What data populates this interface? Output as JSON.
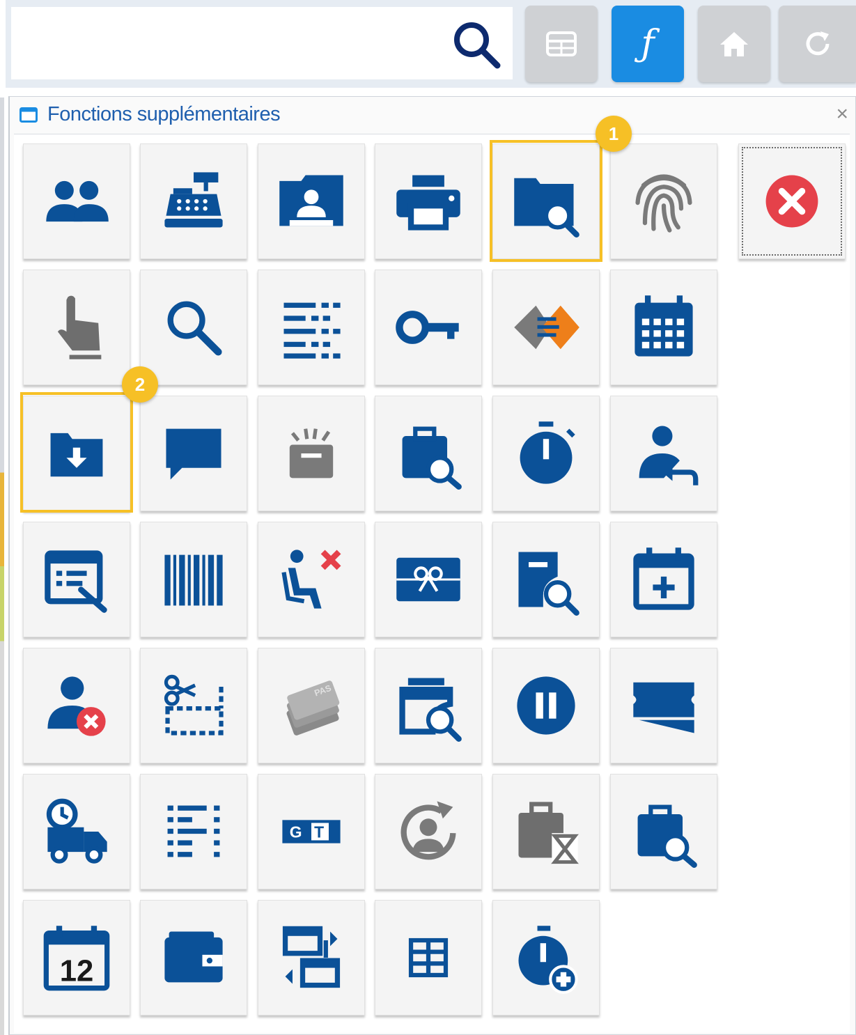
{
  "panel": {
    "title": "Fonctions supplémentaires",
    "close_glyph": "×"
  },
  "toolbar": {
    "buttons": [
      {
        "name": "grid-view-icon",
        "color": "#cfd1d4"
      },
      {
        "name": "function-icon",
        "color": "#1a8ce2",
        "label": "ƒ"
      },
      {
        "name": "home-icon",
        "color": "#cfd1d4"
      },
      {
        "name": "refresh-icon",
        "color": "#cfd1d4"
      }
    ]
  },
  "colors": {
    "primary": "#0b5198",
    "accent_blue": "#1a8ce2",
    "highlight": "#f6c026",
    "danger": "#e5414a",
    "grey": "#7a7a7a",
    "orange": "#ee7f1a"
  },
  "badges": [
    "1",
    "2"
  ],
  "tiles": [
    "users-icon",
    "cash-register-icon",
    "contact-folder-icon",
    "printer-icon",
    "folder-search-icon",
    "fingerprint-icon",
    "close-circle-icon",
    "hand-pointer-icon",
    "search-icon",
    "list-icon",
    "key-icon",
    "diamond-arrows-icon",
    "calendar-grid-icon",
    "folder-download-icon",
    "chat-bubble-icon",
    "broken-box-icon",
    "bag-search-icon",
    "stopwatch-icon",
    "user-return-icon",
    "form-edit-icon",
    "barcode-icon",
    "no-seat-icon",
    "gift-card-icon",
    "document-search-icon",
    "calendar-add-icon",
    "user-remove-icon",
    "cut-coupon-icon",
    "cards-stack-icon",
    "archive-search-icon",
    "pause-icon",
    "ticket-icon",
    "delivery-truck-icon",
    "dotted-list-icon",
    "gt-card-icon",
    "user-refresh-icon",
    "bag-hourglass-icon",
    "bag-search-icon",
    "calendar-12-icon",
    "wallet-icon",
    "transfer-icon",
    "table-icon",
    "stopwatch-add-icon"
  ],
  "texts": {
    "card_pas": "PAS",
    "card_g": "G",
    "card_t": "T",
    "calendar_day": "12"
  }
}
